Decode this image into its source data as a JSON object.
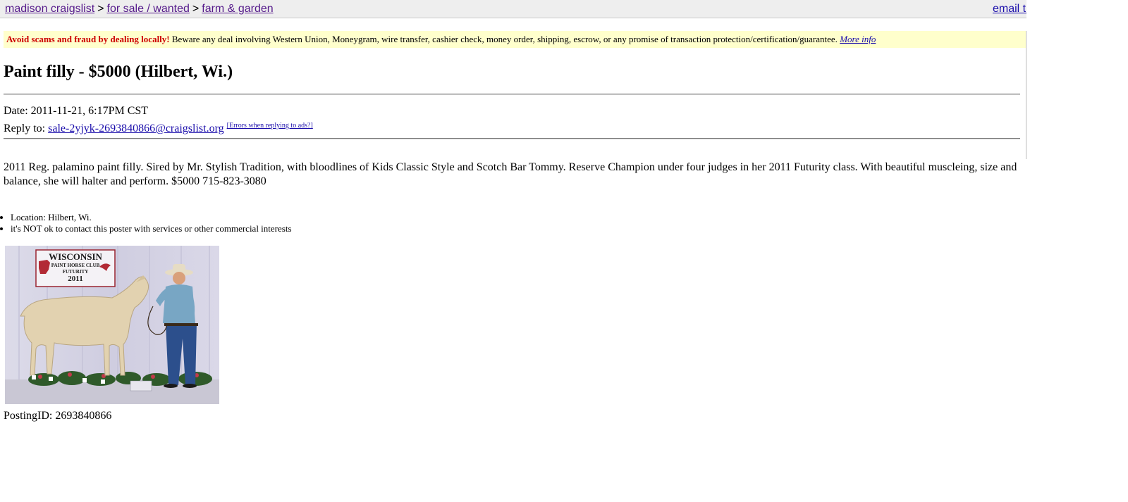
{
  "breadcrumb": {
    "site": "madison craigslist",
    "category": "for sale / wanted",
    "subcategory": "farm & garden",
    "separator": ">"
  },
  "header_right_link": "email th",
  "scam_notice": {
    "warning": "Avoid scams and fraud by dealing locally!",
    "text": "Beware any deal involving Western Union, Moneygram, wire transfer, cashier check, money order, shipping, escrow, or any promise of transaction protection/certification/guarantee.",
    "more_info": "More info"
  },
  "post": {
    "title": "Paint filly - $5000 (Hilbert, Wi.)",
    "date_label": "Date:",
    "date": "2011-11-21, 6:17PM CST",
    "reply_label": "Reply to:",
    "reply_email": "sale-2yjyk-2693840866@craigslist.org",
    "reply_errors": "[Errors when replying to ads?]",
    "body": "2011 Reg. palamino paint filly. Sired by Mr. Stylish Tradition, with bloodlines of Kids Classic Style and Scotch Bar Tommy. Reserve Champion under four judges in her 2011 Futurity class. With beautiful muscleing, size and balance, she will halter and perform. $5000 715-823-3080",
    "attributes": [
      "Location: Hilbert, Wi.",
      "it's NOT ok to contact this poster with services or other commercial interests"
    ],
    "posting_id": "PostingID: 2693840866"
  },
  "photo": {
    "banner_line1": "WISCONSIN",
    "banner_line2": "PAINT HORSE CLUB",
    "banner_line3": "FUTURITY",
    "banner_line4": "2011",
    "backdrop_color": "#d8d6e6",
    "horse_color": "#e2d2b0",
    "shirt_color": "#78a6c4",
    "jeans_color": "#2c4f8c"
  }
}
